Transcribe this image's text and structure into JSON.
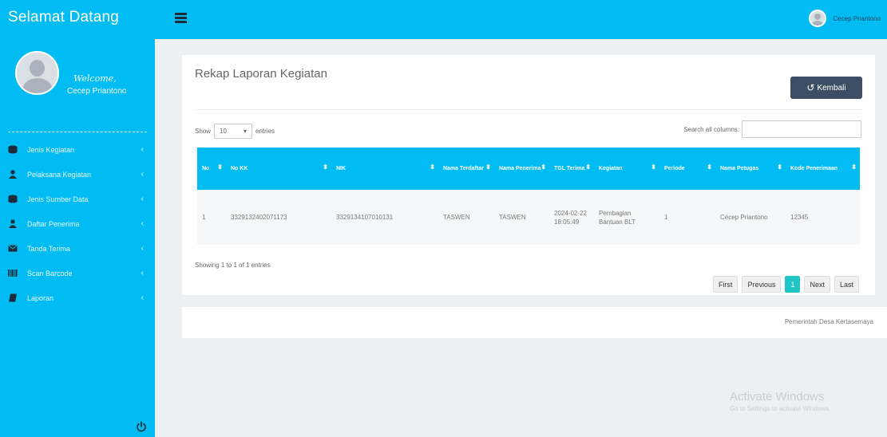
{
  "sidebar": {
    "brand": "Selamat Datang",
    "welcome": "Welcome,",
    "username": "Cecep Priantono",
    "items": [
      {
        "label": "Jenis Kegiatan",
        "icon": "database-icon"
      },
      {
        "label": "Pelaksana Kegiatan",
        "icon": "user-icon"
      },
      {
        "label": "Jenis Sumber Data",
        "icon": "database-icon"
      },
      {
        "label": "Daftar Penerima",
        "icon": "user-icon"
      },
      {
        "label": "Tanda Terima",
        "icon": "envelope-icon"
      },
      {
        "label": "Scan Barcode",
        "icon": "barcode-icon"
      },
      {
        "label": "Laporan",
        "icon": "book-icon"
      }
    ]
  },
  "topbar": {
    "user_name": "Cecep Priantono"
  },
  "panel": {
    "title": "Rekap Laporan Kegiatan",
    "back_label": "Kembali",
    "show_label": "Show",
    "entries_value": "10",
    "entries_label": "entries",
    "search_label": "Search all columns:",
    "search_value": ""
  },
  "table": {
    "headers": [
      "No",
      "No KK",
      "NIK",
      "Nama Terdaftar",
      "Nama Penerima",
      "TGL Terima",
      "Kegiatan",
      "Periode",
      "Nama Petugas",
      "Kode Penerimaan"
    ],
    "rows": [
      [
        "1",
        "3329132402071173",
        "3329134107010131",
        "TASWEN",
        "TASWEN",
        "2024-02-22 18:05:49",
        "Pembagian Bantuan BLT",
        "1",
        "Cecep Priantono",
        "12345"
      ]
    ]
  },
  "info": "Showing 1 to 1 of 1 entries",
  "pagination": {
    "first": "First",
    "previous": "Previous",
    "current": "1",
    "next": "Next",
    "last": "Last"
  },
  "footer": {
    "text": "Pemerintah Desa Kertasemaya"
  },
  "watermark": {
    "line1": "Activate Windows",
    "line2": "Go to Settings to activate Windows."
  },
  "colors": {
    "accent": "#00bcf2",
    "button_dark": "#3c4e63",
    "pagination_active": "#21c5c5"
  }
}
